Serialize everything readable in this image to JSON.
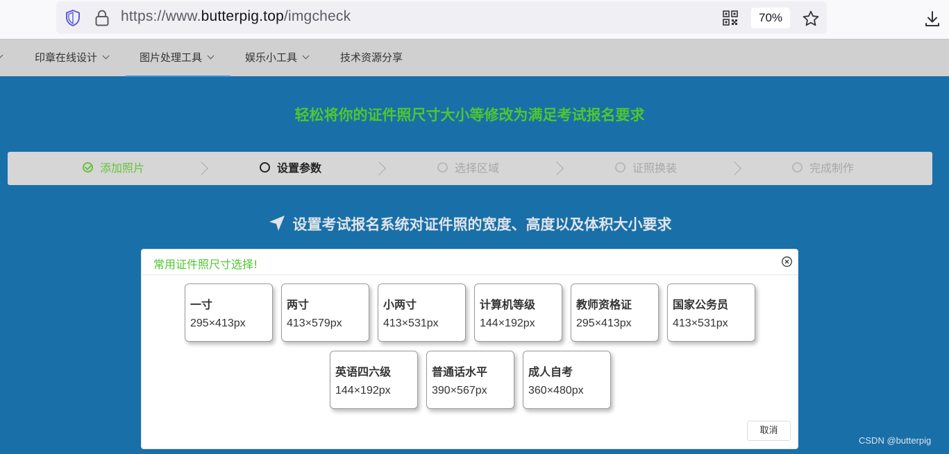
{
  "browser": {
    "url_scheme": "https://www.",
    "url_domain": "butterpig.top",
    "url_path": "/imgcheck",
    "zoom": "70%"
  },
  "nav": {
    "items": [
      {
        "label": "印章在线设计",
        "has_dropdown": true,
        "active": false
      },
      {
        "label": "图片处理工具",
        "has_dropdown": true,
        "active": true
      },
      {
        "label": "娱乐小工具",
        "has_dropdown": true,
        "active": false
      },
      {
        "label": "技术资源分享",
        "has_dropdown": false,
        "active": false
      }
    ]
  },
  "hero": {
    "title": "轻松将你的证件照尺寸大小等修改为满足考试报名要求"
  },
  "steps": [
    {
      "label": "添加照片",
      "state": "done"
    },
    {
      "label": "设置参数",
      "state": "active"
    },
    {
      "label": "选择区域",
      "state": "pending"
    },
    {
      "label": "证照换装",
      "state": "pending"
    },
    {
      "label": "完成制作",
      "state": "pending"
    }
  ],
  "section": {
    "title": "设置考试报名系统对证件照的宽度、高度以及体积大小要求"
  },
  "dialog": {
    "title": "常用证件照尺寸选择!",
    "cancel_label": "取消",
    "sizes": [
      {
        "name": "一寸",
        "size": "295×413px"
      },
      {
        "name": "两寸",
        "size": "413×579px"
      },
      {
        "name": "小两寸",
        "size": "413×531px"
      },
      {
        "name": "计算机等级",
        "size": "144×192px"
      },
      {
        "name": "教师资格证",
        "size": "295×413px"
      },
      {
        "name": "国家公务员",
        "size": "413×531px"
      },
      {
        "name": "英语四六级",
        "size": "144×192px"
      },
      {
        "name": "普通话水平",
        "size": "390×567px"
      },
      {
        "name": "成人自考",
        "size": "360×480px"
      }
    ]
  },
  "watermark": "CSDN @butterpig",
  "colors": {
    "accent_green": "#4ec72f",
    "page_blue": "#196fa8",
    "nav_active": "#3f8ed8"
  }
}
